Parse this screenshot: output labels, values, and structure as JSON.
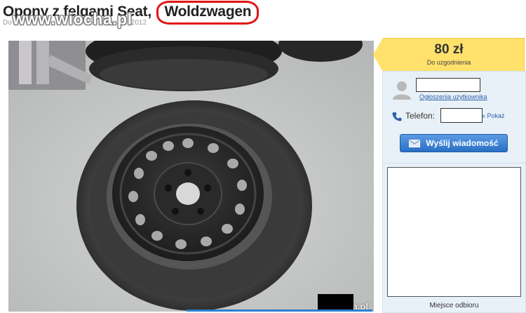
{
  "listing": {
    "title_prefix": "Opony z felgami Seat,",
    "title_highlight": "Woldzwagen",
    "meta_prefix": "Do",
    "meta_date": "2012"
  },
  "watermark": {
    "text": "www.wiocha.pl"
  },
  "photo": {
    "credit": "a.pl"
  },
  "price": {
    "value": "80 zł",
    "note": "Do uzgodnienia"
  },
  "seller": {
    "profile_link": "Ogłoszenia użytkownika",
    "phone_label": "Telefon:",
    "show_phone": "« Pokaż"
  },
  "actions": {
    "send_message": "Wyślij wiadomość"
  },
  "location": {
    "label": "Miejsce odbioru"
  },
  "colors": {
    "highlight_ring": "#e01515",
    "price_bg": "#ffe16b",
    "panel_bg": "#e8f0f8",
    "button_blue": "#2a6fc4",
    "link_blue": "#2c5fa8"
  },
  "icons": {
    "avatar": "user-avatar-icon",
    "phone": "phone-icon",
    "envelope": "envelope-icon"
  }
}
